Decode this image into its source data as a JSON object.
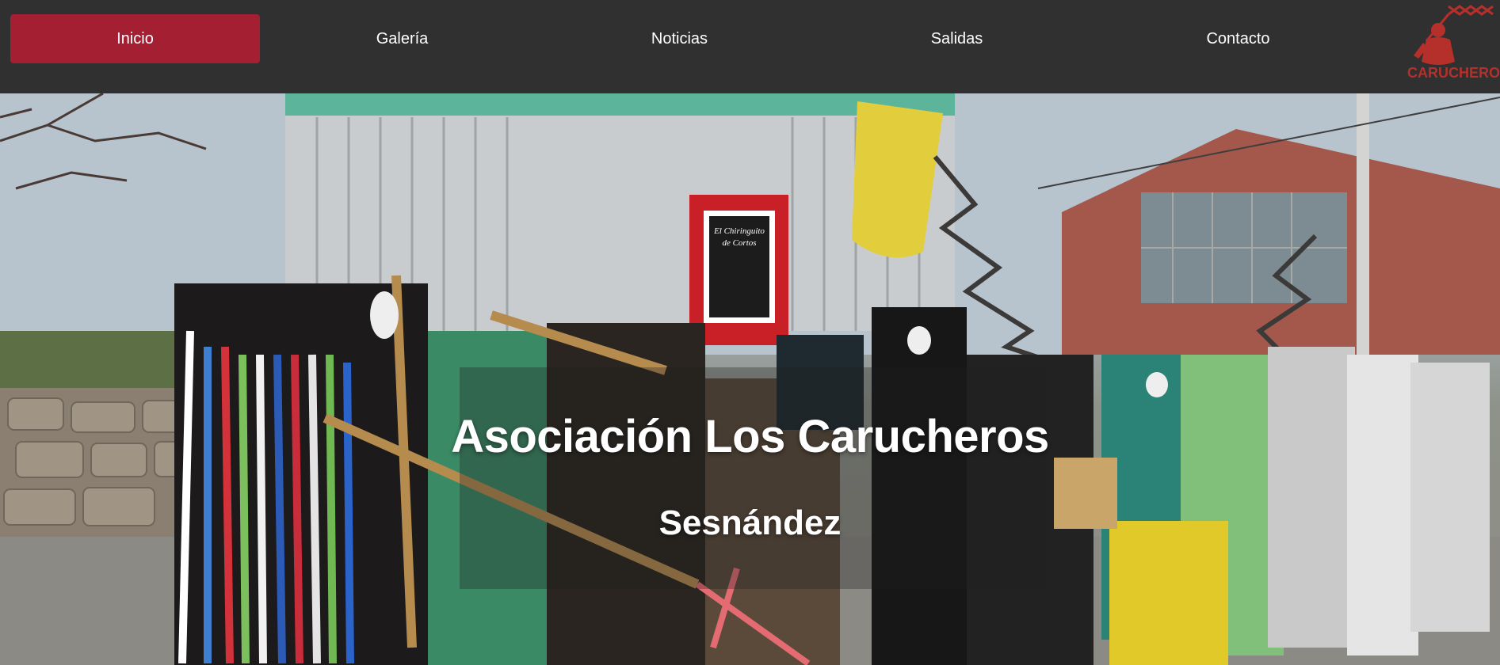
{
  "nav": {
    "items": [
      {
        "label": "Inicio",
        "active": true
      },
      {
        "label": "Galería",
        "active": false
      },
      {
        "label": "Noticias",
        "active": false
      },
      {
        "label": "Salidas",
        "active": false
      },
      {
        "label": "Contacto",
        "active": false
      }
    ],
    "logo_text": "CARUCHEROS",
    "active_color": "#a51f33",
    "bar_color": "#303030"
  },
  "hero": {
    "title": "Asociación Los Carucheros",
    "subtitle": "Sesnández",
    "image_icon": "hero-photo",
    "poster_text_line1": "El Chiringuito",
    "poster_text_line2": "de Cortos"
  }
}
